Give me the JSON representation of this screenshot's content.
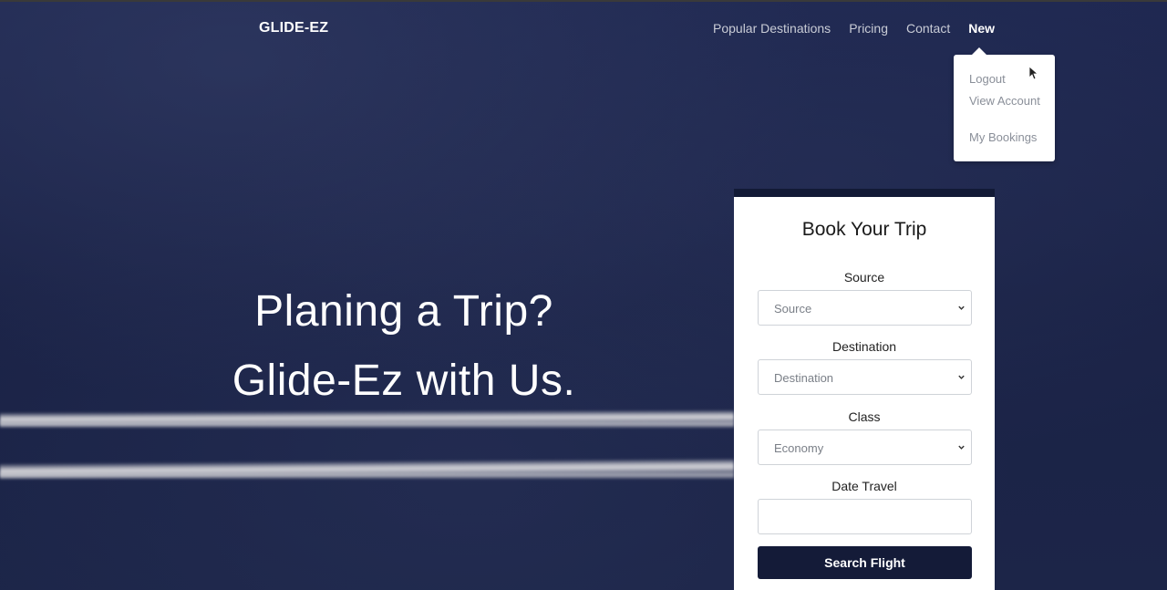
{
  "nav": {
    "brand": "GLIDE-EZ",
    "links": [
      "Popular Destinations",
      "Pricing",
      "Contact"
    ],
    "active_link": "New"
  },
  "dropdown": {
    "items": [
      "Logout",
      "View Account",
      "My Bookings"
    ]
  },
  "hero": {
    "line1": "Planing a Trip?",
    "line2": "Glide-Ez with Us."
  },
  "booking": {
    "title": "Book Your Trip",
    "source_label": "Source",
    "source_value": "Source",
    "destination_label": "Destination",
    "destination_value": "Destination",
    "class_label": "Class",
    "class_value": "Economy",
    "date_label": "Date Travel",
    "date_value": "",
    "search_label": "Search Flight"
  },
  "colors": {
    "background": "#1b2448",
    "button": "#141b38",
    "card": "#ffffff"
  },
  "icons": [
    "chevron-down-icon",
    "mouse-cursor-icon"
  ]
}
